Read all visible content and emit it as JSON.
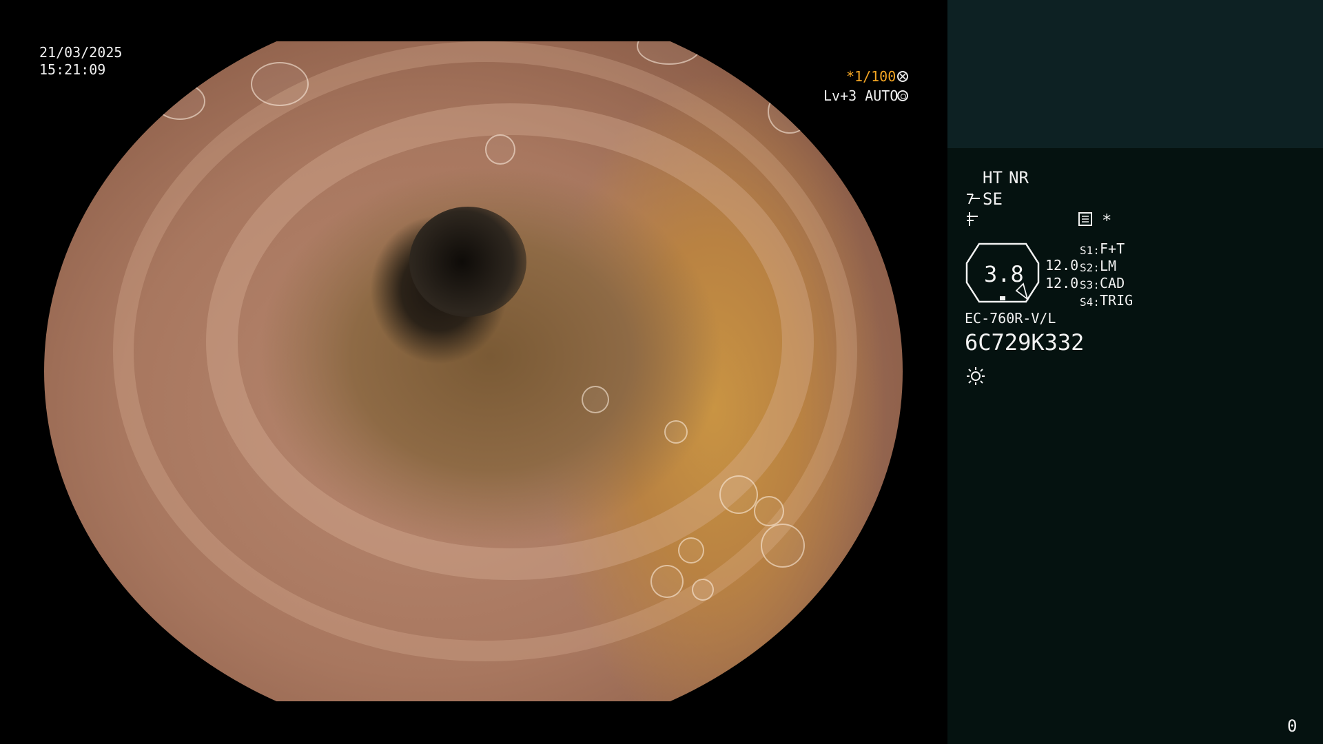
{
  "video_overlay": {
    "date": "21/03/2025",
    "time": "15:21:09",
    "shutter": "*1/100",
    "level": "Lv+3 AUTO"
  },
  "side_panel": {
    "ht_label": "HT",
    "nr_label": "NR",
    "se_label": "SE",
    "star_label": "*",
    "scope_value": "3.8",
    "value_top": "12.0",
    "value_bottom": "12.0",
    "switches": [
      {
        "key": "S1:",
        "value": "F+T"
      },
      {
        "key": "S2:",
        "value": "LM"
      },
      {
        "key": "S3:",
        "value": "CAD"
      },
      {
        "key": "S4:",
        "value": "TRIG"
      }
    ],
    "scope_model": "EC-760R-V/L",
    "serial": "6C729K332",
    "counter": "0"
  },
  "colors": {
    "accent_orange": "#f5a623",
    "panel_bg": "#051210",
    "panel_top_bg": "#0d2123"
  },
  "icons": [
    "aperture-icon",
    "iris-icon",
    "ht-mode-icon",
    "freeze-icon",
    "settings-panel-icon",
    "light-icon"
  ]
}
